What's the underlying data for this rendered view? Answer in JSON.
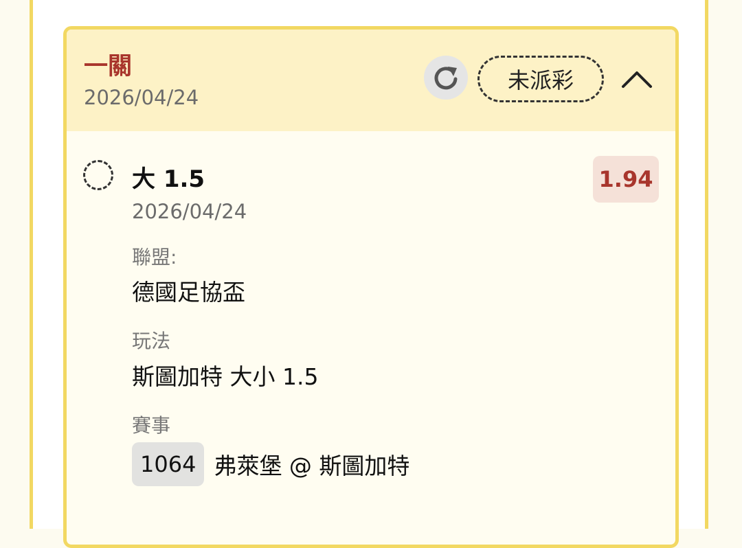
{
  "card": {
    "bet_type": "一關",
    "date": "2026/04/24",
    "status": "未派彩",
    "refresh_icon": "refresh-icon",
    "collapse_icon": "chevron-up-icon"
  },
  "selection": {
    "title": "大 1.5",
    "date": "2026/04/24",
    "odds": "1.94",
    "league_label": "聯盟:",
    "league_value": "德國足協盃",
    "play_label": "玩法",
    "play_value": "斯圖加特 大小 1.5",
    "event_label": "賽事",
    "event_code": "1064",
    "event_name": "弗萊堡 @ 斯圖加特"
  },
  "colors": {
    "accent": "#a8352c",
    "border": "#f2d862",
    "header_bg": "#fdf2c6",
    "card_bg": "#fffdf1"
  }
}
